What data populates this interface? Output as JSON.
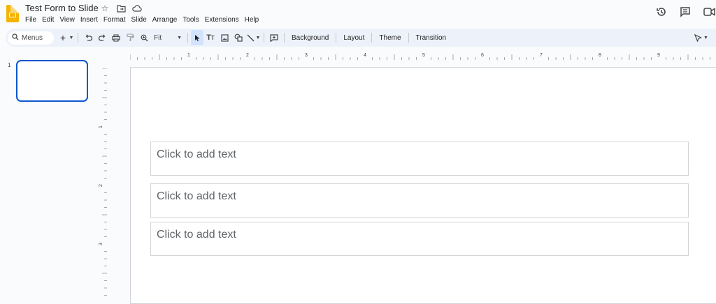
{
  "header": {
    "doc_title": "Test Form to Slide",
    "title_icons": [
      "star-icon",
      "move-folder-icon",
      "cloud-status-icon"
    ],
    "menu": [
      "File",
      "Edit",
      "View",
      "Insert",
      "Format",
      "Slide",
      "Arrange",
      "Tools",
      "Extensions",
      "Help"
    ],
    "right_icons": [
      "version-history-icon",
      "comments-icon",
      "meet-icon"
    ]
  },
  "toolbar": {
    "menus_label": "Menus",
    "zoom_value": "Fit",
    "buttons": [
      "Background",
      "Layout",
      "Theme",
      "Transition"
    ]
  },
  "filmstrip": {
    "slides": [
      {
        "number": "1"
      }
    ]
  },
  "ruler": {
    "horizontal_labels": [
      "1",
      "2",
      "3",
      "4",
      "5",
      "6",
      "7",
      "8",
      "9"
    ],
    "vertical_labels": [
      "1",
      "2",
      "3"
    ]
  },
  "slide": {
    "placeholders": [
      "Click to add text",
      "Click to add text",
      "Click to add text"
    ]
  },
  "colors": {
    "accent": "#0b57d0",
    "toolbar_bg": "#edf2fa",
    "logo": "#f4b400"
  }
}
